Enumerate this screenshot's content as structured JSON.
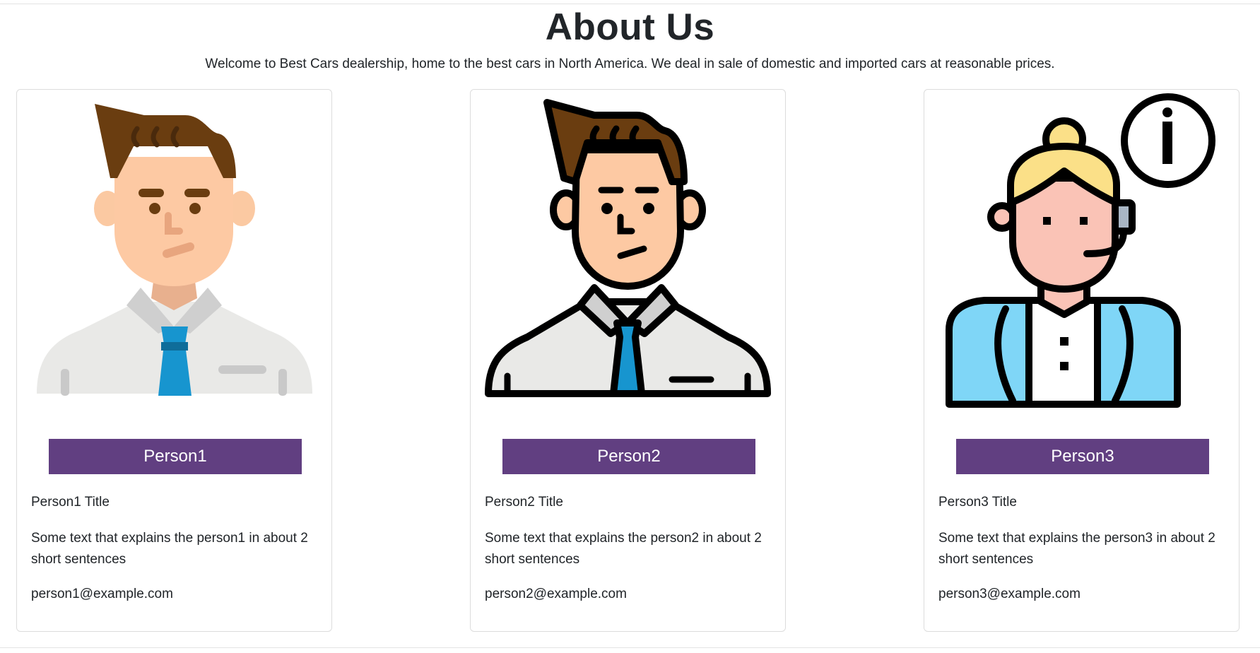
{
  "page": {
    "title": "About Us",
    "intro": "Welcome to Best Cars dealership, home to the best cars in North America. We deal in sale of domestic and imported cars at reasonable prices."
  },
  "people": [
    {
      "name": "Person1",
      "title": "Person1 Title",
      "description": "Some text that explains the person1 in about 2 short sentences",
      "email": "person1@example.com",
      "avatar_icon": "businessman-flat-icon"
    },
    {
      "name": "Person2",
      "title": "Person2 Title",
      "description": "Some text that explains the person2 in about 2 short sentences",
      "email": "person2@example.com",
      "avatar_icon": "businessman-outline-icon"
    },
    {
      "name": "Person3",
      "title": "Person3 Title",
      "description": "Some text that explains the person3 in about 2 short sentences",
      "email": "person3@example.com",
      "avatar_icon": "support-agent-info-icon"
    }
  ],
  "colors": {
    "banner": "#613f81",
    "text": "#212529",
    "border": "#dcdcdc"
  }
}
